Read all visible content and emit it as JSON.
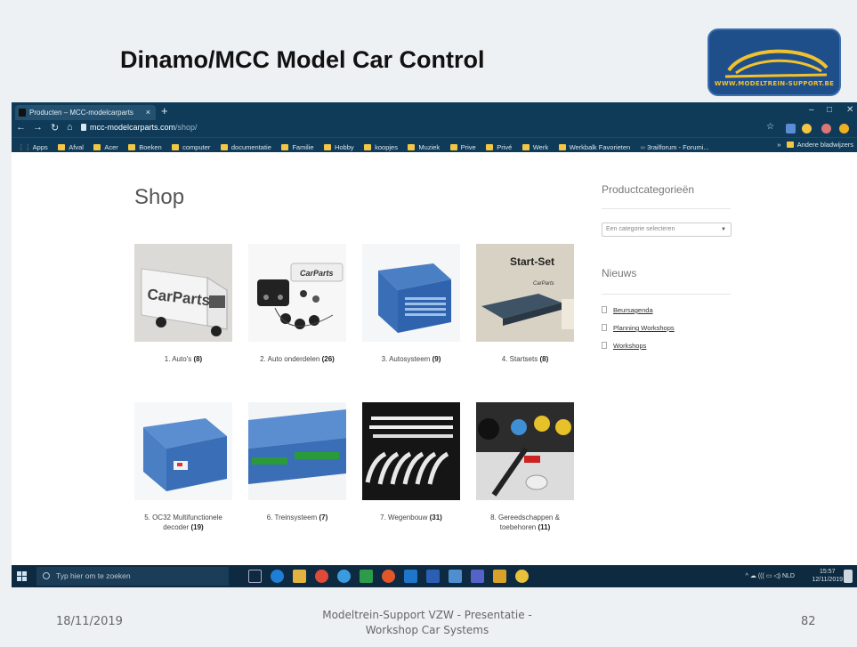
{
  "slide": {
    "title": "Dinamo/MCC Model Car Control",
    "logo_text": "WWW.MODELTREIN-SUPPORT.BE",
    "footer_date": "18/11/2019",
    "footer_line1": "Modeltrein-Support  VZW - Presentatie -",
    "footer_line2": "Workshop  Car Systems",
    "page_number": "82"
  },
  "browser": {
    "tab_title": "Producten – MCC-modelcarparts",
    "tab_close": "×",
    "new_tab": "+",
    "url_host": "mcc-modelcarparts.com",
    "url_path": "/shop/",
    "bookmarks": [
      "Apps",
      "Afval",
      "Acer",
      "Boeken",
      "computer",
      "documentatie",
      "Familie",
      "Hobby",
      "koopjes",
      "Muziek",
      "Prive",
      "Privé",
      "Werk",
      "Werkbalk Favorieten",
      "3railforum - Forumi..."
    ],
    "bookmark_overflow": "»",
    "bookmark_other": "Andere bladwijzers"
  },
  "page": {
    "title": "Shop",
    "products": [
      {
        "name": "1. Auto's",
        "count": "(8)"
      },
      {
        "name": "2. Auto onderdelen",
        "count": "(26)"
      },
      {
        "name": "3. Autosysteem",
        "count": "(9)"
      },
      {
        "name": "4. Startsets",
        "count": "(8)"
      },
      {
        "name": "5. OC32 Multifunctionele decoder",
        "count": "(19)"
      },
      {
        "name": "6. Treinsysteem",
        "count": "(7)"
      },
      {
        "name": "7. Wegenbouw",
        "count": "(31)"
      },
      {
        "name": "8. Gereedschappen & toebehoren",
        "count": "(11)"
      }
    ],
    "thumb_labels": {
      "carparts": "CarParts",
      "startset": "Start-Set"
    },
    "sidebar": {
      "categories_heading": "Productcategorieën",
      "select_placeholder": "Een categorie selecteren",
      "news_heading": "Nieuws",
      "news_items": [
        "Beursagenda",
        "Planning Workshops",
        "Workshops"
      ]
    }
  },
  "taskbar": {
    "search_placeholder": "Typ hier om te zoeken",
    "language": "NLD",
    "time": "15:57",
    "date": "12/11/2019"
  },
  "colors": {
    "browser_chrome": "#0f3b59",
    "taskbar": "#0d2a40",
    "slide_bg": "#eef1f4",
    "logo_bg": "#1f4f8a",
    "logo_accent": "#f2c12e"
  }
}
